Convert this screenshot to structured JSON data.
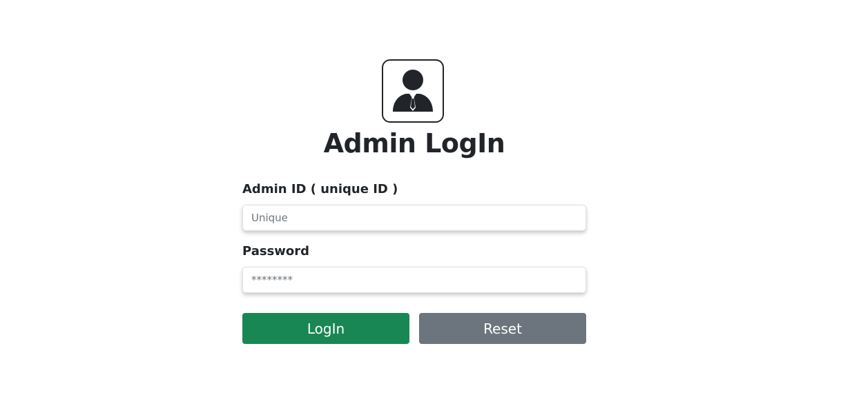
{
  "header": {
    "logo_icon": "admin-user-icon",
    "title": "Admin LogIn"
  },
  "form": {
    "admin_id": {
      "label": "Admin ID ( unique ID )",
      "placeholder": "Unique",
      "value": ""
    },
    "password": {
      "label": "Password",
      "placeholder": "********",
      "value": ""
    },
    "login_label": "LogIn",
    "reset_label": "Reset"
  },
  "colors": {
    "login_button": "#198754",
    "reset_button": "#6c757d",
    "text": "#212529"
  }
}
